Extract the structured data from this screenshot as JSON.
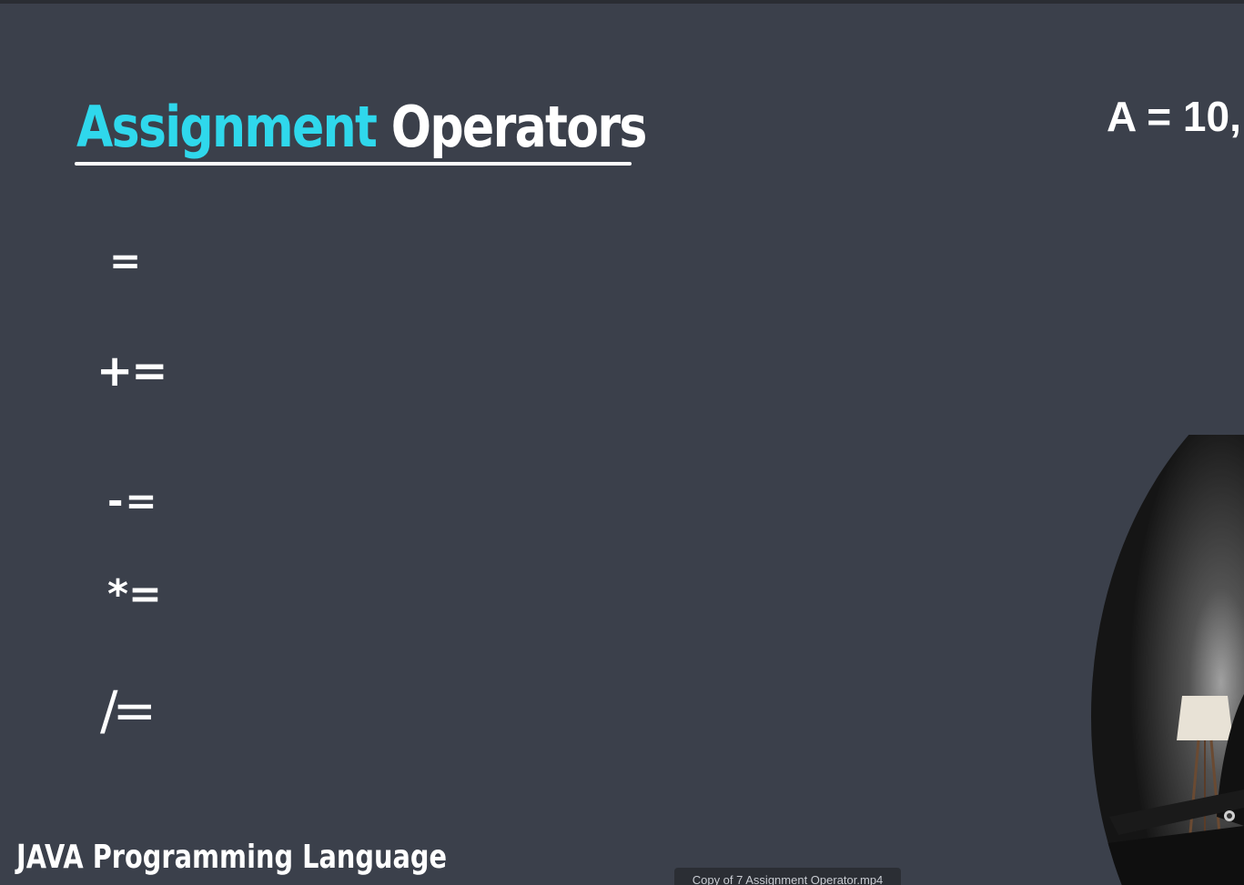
{
  "slide": {
    "title_accent": "Assignment",
    "title_main": "Operators",
    "formula_text": "A = 10,",
    "operators": [
      "=",
      "+=",
      "-=",
      "*=",
      "/="
    ],
    "footer_label": "JAVA Programming Language"
  },
  "player": {
    "tooltip_filename": "Copy of 7 Assignment Operator.mp4"
  },
  "colors": {
    "background": "#3b404b",
    "accent": "#2fd8ec",
    "text": "#ffffff"
  },
  "webcam": {
    "icon": "webcam-feed"
  }
}
